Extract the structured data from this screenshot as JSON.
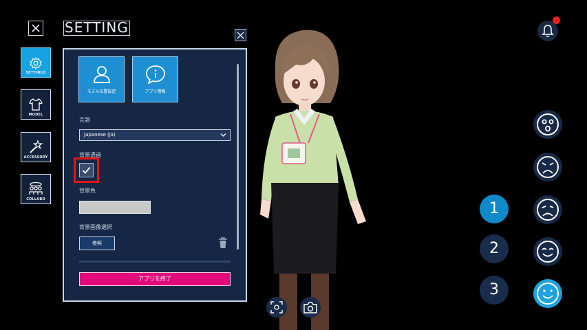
{
  "header": {
    "title": "SETTING"
  },
  "nav": {
    "items": [
      {
        "label": "SETTINGS",
        "icon": "gear-icon",
        "active": true
      },
      {
        "label": "MODEL",
        "icon": "shirt-icon",
        "active": false
      },
      {
        "label": "ACCESSORY",
        "icon": "star-wand-icon",
        "active": false
      },
      {
        "label": "COLLABO",
        "icon": "people-icon",
        "active": false
      }
    ]
  },
  "panel": {
    "tiles": [
      {
        "label": "モデル位置設定",
        "icon": "person-icon"
      },
      {
        "label": "アプリ情報",
        "icon": "info-chat-icon"
      }
    ],
    "language": {
      "label": "言語",
      "value": "Japanese (ja)"
    },
    "transparency": {
      "label": "背景透過",
      "checked": true
    },
    "bg_color": {
      "label": "背景色",
      "value": "#c8c8c8"
    },
    "bg_image": {
      "label": "背景画像選択",
      "button": "参照"
    },
    "quit_button": "アプリを終了"
  },
  "right": {
    "numbers": [
      {
        "label": "1",
        "active": true
      },
      {
        "label": "2",
        "active": false
      },
      {
        "label": "3",
        "active": false
      }
    ],
    "faces": [
      {
        "icon": "surprised-face-icon",
        "active": false
      },
      {
        "icon": "angry-face-icon",
        "active": false
      },
      {
        "icon": "sad-face-icon",
        "active": false
      },
      {
        "icon": "smile-face-icon",
        "active": false
      },
      {
        "icon": "happy-face-icon",
        "active": true
      }
    ]
  },
  "colors": {
    "accent": "#15a3e3",
    "quit": "#e3097b",
    "panel": "#152744",
    "alert": "#f01d1d"
  }
}
